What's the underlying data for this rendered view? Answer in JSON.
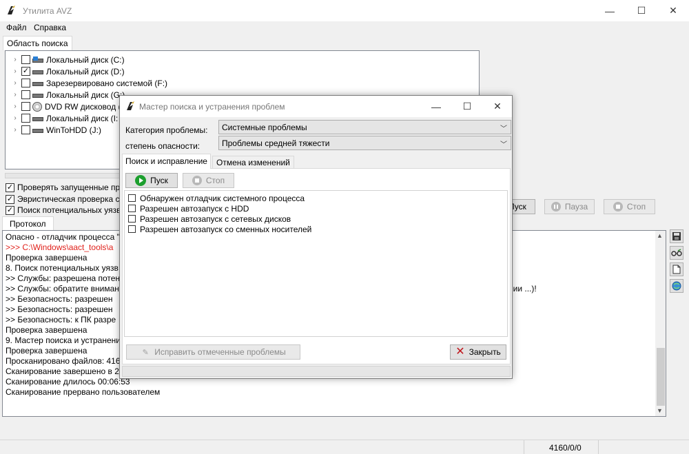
{
  "window": {
    "title": "Утилита AVZ",
    "caption": {
      "minimize": "—",
      "maximize": "☐",
      "close": "✕"
    }
  },
  "menu": {
    "file": "Файл",
    "help": "Справка"
  },
  "search_area": {
    "tab_label": "Область поиска",
    "drives": [
      {
        "label": "Локальный диск (C:)",
        "checked": false,
        "icon": "windows-drive-icon"
      },
      {
        "label": "Локальный диск (D:)",
        "checked": true,
        "icon": "drive-icon"
      },
      {
        "label": "Зарезервировано системой (F:)",
        "checked": false,
        "icon": "drive-icon"
      },
      {
        "label": "Локальный диск (G:)",
        "checked": false,
        "icon": "drive-icon"
      },
      {
        "label": "DVD RW дисковод (",
        "checked": false,
        "icon": "dvd-icon"
      },
      {
        "label": "Локальный диск (I:",
        "checked": false,
        "icon": "drive-icon"
      },
      {
        "label": "WinToHDD (J:)",
        "checked": false,
        "icon": "drive-icon"
      }
    ]
  },
  "options": [
    {
      "label": "Проверять запущенные пр",
      "checked": true
    },
    {
      "label": "Эвристическая проверка с",
      "checked": true
    },
    {
      "label": "Поиск потенциальных уязв",
      "checked": true
    }
  ],
  "main_buttons": {
    "start": "Пуск",
    "pause": "Пауза",
    "stop": "Стоп"
  },
  "protocol": {
    "tab_label": "Протокол",
    "lines": [
      {
        "text": "Опасно - отладчик процесса \"",
        "color": "#000000"
      },
      {
        "text": ">>> C:\\Windows\\aact_tools\\a",
        "color": "#e0201a"
      },
      {
        "text": "Проверка завершена",
        "color": "#000000"
      },
      {
        "text": "8. Поиск потенциальных уязв",
        "color": "#000000"
      },
      {
        "text": ">> Службы: разрешена потен",
        "color": "#000000"
      },
      {
        "text": ">> Службы: обратите внимани",
        "color": "#000000"
      },
      {
        "text": ">> Безопасность: разрешен",
        "color": "#000000"
      },
      {
        "text": ">> Безопасность: разрешен",
        "color": "#000000"
      },
      {
        "text": ">> Безопасность: к ПК разре",
        "color": "#000000"
      },
      {
        "text": "Проверка завершена",
        "color": "#000000"
      },
      {
        "text": "9. Мастер поиска и устранени",
        "color": "#000000"
      },
      {
        "text": "Проверка завершена",
        "color": "#000000"
      },
      {
        "text": "Просканировано файлов: 416",
        "color": "#000000"
      },
      {
        "text": "Сканирование завершено в 2",
        "color": "#000000"
      },
      {
        "text": "Сканирование длилось 00:06:53",
        "color": "#000000"
      },
      {
        "text": "Сканирование прервано пользователем",
        "color": "#000000"
      }
    ],
    "right_fragment": "нии ...)!"
  },
  "side_tools": [
    "save-icon",
    "glasses-icon",
    "new-document-icon",
    "globe-icon"
  ],
  "status": {
    "counter": "4160/0/0"
  },
  "dialog": {
    "title": "Мастер поиска и устранения проблем",
    "category_label": "Категория проблемы:",
    "category_value": "Системные проблемы",
    "severity_label": "степень опасности:",
    "severity_value": "Проблемы средней тяжести",
    "tabs": [
      "Поиск и исправление",
      "Отмена изменений"
    ],
    "start": "Пуск",
    "stop": "Стоп",
    "problems": [
      {
        "label": "Обнаружен отладчик системного процесса",
        "checked": false
      },
      {
        "label": "Разрешен автозапуск с HDD",
        "checked": false
      },
      {
        "label": "Разрешен автозапуск с сетевых дисков",
        "checked": false
      },
      {
        "label": "Разрешен автозапуск со сменных носителей",
        "checked": false
      }
    ],
    "fix_button": "Исправить отмеченные проблемы",
    "close_button": "Закрыть"
  }
}
